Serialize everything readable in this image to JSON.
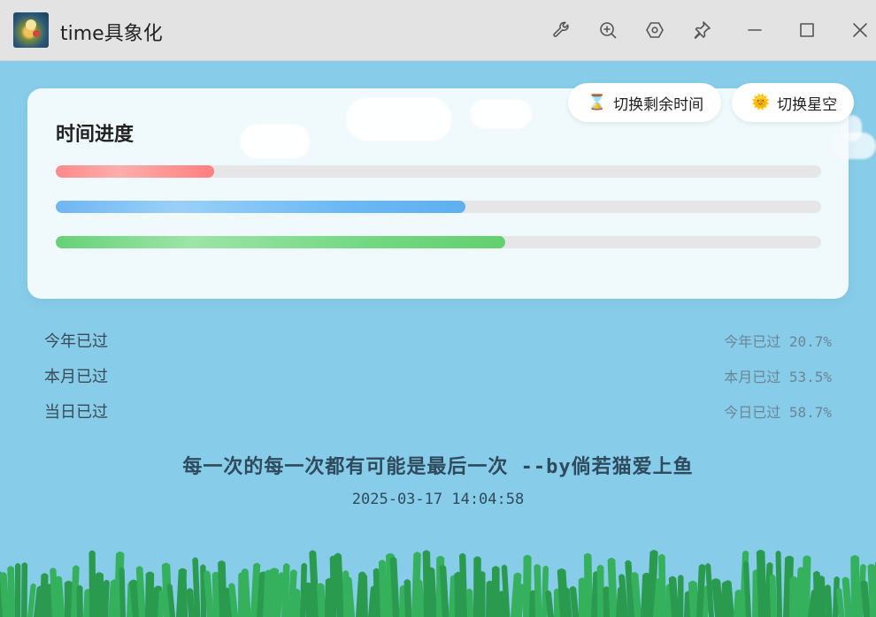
{
  "window": {
    "title": "time具象化",
    "controls": [
      "wrench-icon",
      "zoom-in-icon",
      "settings-hex-icon",
      "pin-icon",
      "minimize-icon",
      "maximize-icon",
      "close-icon"
    ]
  },
  "card": {
    "title": "时间进度",
    "bars": [
      {
        "name": "year",
        "progress": 0.207,
        "color": "#ff8a8a"
      },
      {
        "name": "month",
        "progress": 0.535,
        "color": "#6fb6f3"
      },
      {
        "name": "day",
        "progress": 0.587,
        "color": "#66d177"
      }
    ]
  },
  "buttons": {
    "remaining": {
      "label": "切换剩余时间",
      "icon": "hourglass-icon"
    },
    "starry": {
      "label": "切换星空",
      "icon": "sun-icon"
    }
  },
  "stats": [
    {
      "label": "今年已过",
      "value": "今年已过 20.7%"
    },
    {
      "label": "本月已过",
      "value": "本月已过 53.5%"
    },
    {
      "label": "当日已过",
      "value": "今日已过 58.7%"
    }
  ],
  "quote": "每一次的每一次都有可能是最后一次 --by倘若猫爱上鱼",
  "datetime": "2025-03-17 14:04:58",
  "colors": {
    "background": "#87cdea",
    "titlebar": "#e3e3e3",
    "grass": "#2eaa55"
  }
}
